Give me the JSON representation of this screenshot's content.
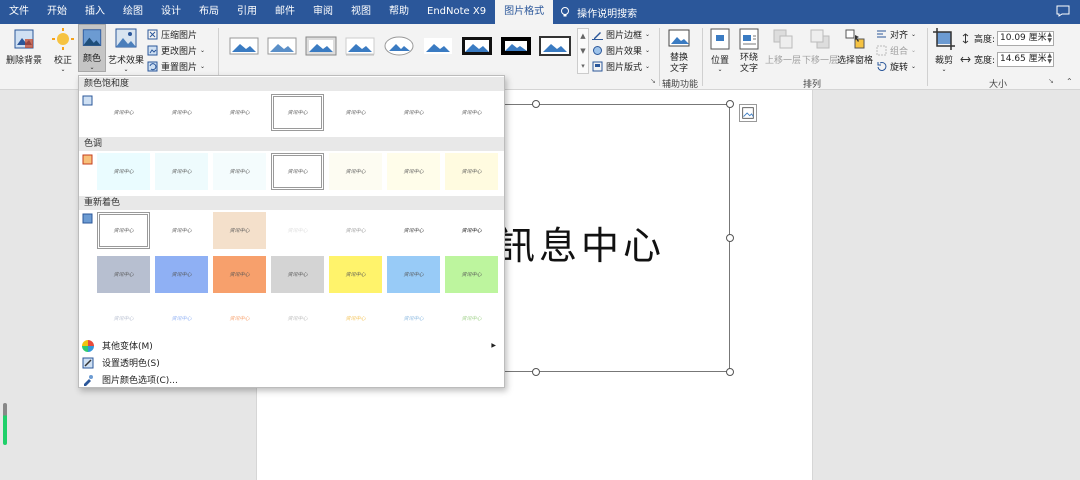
{
  "menubar": {
    "tabs": [
      "文件",
      "开始",
      "插入",
      "绘图",
      "设计",
      "布局",
      "引用",
      "邮件",
      "审阅",
      "视图",
      "帮助",
      "EndNote X9",
      "图片格式"
    ],
    "active_tab": "图片格式",
    "tell_me": "操作说明搜索"
  },
  "ribbon": {
    "remove_bg": "删除背景",
    "corrections": "校正",
    "color": "颜色",
    "artistic": "艺术效果",
    "compress": "压缩图片",
    "change": "更改图片",
    "reset": "重置图片",
    "border": "图片边框",
    "effects": "图片效果",
    "layout": "图片版式",
    "alt_text": "替换文字",
    "accessibility_group": "辅助功能",
    "position": "位置",
    "wrap_text": "环绕文字",
    "bring_forward": "上移一层",
    "send_backward": "下移一层",
    "selection_pane": "选择窗格",
    "align": "对齐",
    "group": "组合",
    "rotate": "旋转",
    "arrange_group": "排列",
    "crop": "裁剪",
    "height_label": "高度:",
    "height_value": "10.09 厘米",
    "width_label": "宽度:",
    "width_value": "14.65 厘米",
    "size_group": "大小"
  },
  "dropdown": {
    "saturation_header": "颜色饱和度",
    "tone_header": "色调",
    "recolor_header": "重新着色",
    "swatch_text": "资讯中心",
    "more_variations": "其他变体(M)",
    "set_transparent": "设置透明色(S)",
    "color_options": "图片颜色选项(C)..."
  },
  "document": {
    "handwriting": "訊息中心"
  },
  "colors": {
    "accent": "#2b579a",
    "recolor_row2": [
      "#b7bfd0",
      "#8fb0f4",
      "#f7a06c",
      "#d4d4d4",
      "#fff36b",
      "#98cbf7",
      "#bdf59e"
    ],
    "recolor_row3": [
      "#b7bfd0",
      "#8fb0f4",
      "#f7a06c",
      "#bbbbbb",
      "#f4c45a",
      "#8ab8e0",
      "#9ed087"
    ],
    "tone_fills": [
      "#eafcff",
      "#eefbfd",
      "#f4fcfd",
      "#ffffff",
      "#fdfcf2",
      "#fffdea",
      "#fffbe0"
    ]
  }
}
